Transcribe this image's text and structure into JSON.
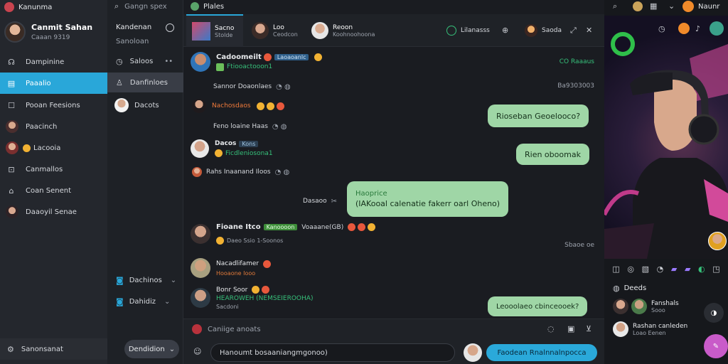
{
  "app": {
    "title": "Kanunma",
    "search_placeholder": "Gangn spex",
    "tab_title": "Plales",
    "top_right_user": "Naunr"
  },
  "profile": {
    "name": "Canmit Sahan",
    "status": "Caaan 9319"
  },
  "sidebar": {
    "items": [
      {
        "label": "Dampinine",
        "icon": "headset-icon"
      },
      {
        "label": "Paaalio",
        "icon": "chat-icon",
        "active": true
      },
      {
        "label": "Pooan Feesions",
        "icon": "doc-icon"
      },
      {
        "label": "Paacinch",
        "icon": "avatar"
      },
      {
        "label": "Lacooia",
        "icon": "emoji-icon"
      },
      {
        "label": "Canmallos",
        "icon": "box-icon"
      },
      {
        "label": "Coan Senent",
        "icon": "monitor-icon"
      },
      {
        "label": "Daaoyil Senae",
        "icon": "avatar"
      }
    ],
    "bottom_label": "Sanonsanat"
  },
  "channels": {
    "title": "Kandenan",
    "subtitle": "Sanoloan",
    "items": [
      {
        "label": "Saloos",
        "icon": "clock-icon"
      },
      {
        "label": "Danfinloes",
        "icon": "user-icon",
        "active": true
      },
      {
        "label": "Dacots",
        "icon": "avatar"
      }
    ],
    "groups": [
      {
        "label": "Dachinos"
      },
      {
        "label": "Dahidiz"
      }
    ],
    "bottom_button": "Dendidion"
  },
  "chat": {
    "tabs": [
      {
        "title": "Sacno",
        "sub": "Stolde"
      },
      {
        "title": "Loo",
        "sub": "Ceodcon"
      },
      {
        "title": "Reoon",
        "sub": "Koohnoohoona"
      }
    ],
    "header_actions": {
      "status": "Lilanasss",
      "name": "Saoda"
    },
    "messages": [
      {
        "name": "Cadoomeilt",
        "tag": "Laoaoanlc",
        "text": "Ftiooactooon1",
        "time": "CO Raaaus"
      },
      {
        "system": "Sannor Doaonlaes",
        "time": "Ba9303003"
      },
      {
        "name": "Nachosdaos",
        "text": ""
      },
      {
        "system": "Feno loaine Haas",
        "time": ""
      },
      {
        "name": "Dacos",
        "tag": "Kons",
        "text": "Ficdleniosona1",
        "time": ""
      },
      {
        "system": "Rahs Inaanand Iloos",
        "time": ""
      },
      {
        "name": "Fioane Itco",
        "tag": "Kanoooon",
        "text": "Voaaane(GB)",
        "sub": "Daeo Ssio 1-Soonos",
        "time": "Sbaoe oe"
      },
      {
        "name": "Nacadlifamer",
        "text": "Hooaone Iooo"
      },
      {
        "name": "Bonr Soor",
        "text": "HEAROWEH (NEMSEIEROOHA)",
        "sub": "Sacdoni"
      }
    ],
    "bubbles": [
      {
        "text": "Rioseban Geoelooco?"
      },
      {
        "text": "Rien oboomak"
      },
      {
        "title": "Haoprice",
        "text": "(IAKooal calenatie fakerr oarl Oheno)",
        "label": "Dasaoo"
      },
      {
        "text": "Leooolaeo cbinceooek?"
      }
    ],
    "composer_placeholder": "Caniige anoats",
    "input_text": "Hanoumt bosaaniangmgonoo)",
    "send_label": "Faodean Rnalnnalnpocca"
  },
  "stream": {
    "section_title": "Deeds",
    "viewers": [
      {
        "name": "Fanshals",
        "sub": "Sooo"
      },
      {
        "name": "Rashan canleden",
        "sub": "Loao Eenen"
      }
    ]
  },
  "colors": {
    "accent": "#29a7d9",
    "bubble": "#9fd6a6",
    "online": "#36c07a",
    "fab": "#c95bc9"
  }
}
